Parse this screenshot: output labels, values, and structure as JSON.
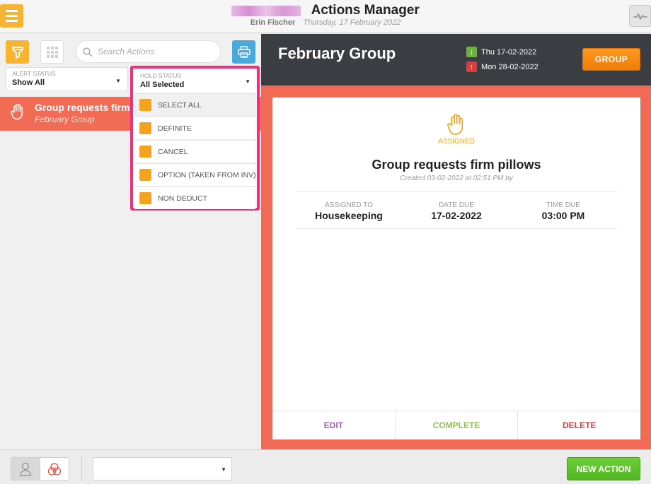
{
  "header": {
    "title": "Actions Manager",
    "user": "Erin Fischer",
    "date": "Thursday, 17 February 2022"
  },
  "icons": {
    "menu": "hamburger-icon",
    "activity": "pulse-icon",
    "filter": "filter-icon",
    "grid": "grid-icon",
    "search": "search-icon",
    "print": "printer-icon",
    "hand": "hand-icon",
    "person": "person-icon",
    "rings": "rings-icon"
  },
  "toolbar": {
    "search_placeholder": "Search Actions"
  },
  "filters": {
    "alert_status": {
      "label": "ALERT STATUS",
      "value": "Show All"
    },
    "hold_status": {
      "label": "HOLD STATUS",
      "value": "All Selected",
      "options": [
        "SELECT ALL",
        "DEFINITE",
        "CANCEL",
        "OPTION (TAKEN FROM INV)",
        "NON DEDUCT"
      ]
    }
  },
  "action_list": [
    {
      "title": "Group requests firm pillows",
      "subtitle": "February Group"
    }
  ],
  "detail": {
    "group_name": "February Group",
    "arrival": "Thu 17-02-2022",
    "departure": "Mon 28-02-2022",
    "group_button": "GROUP",
    "status": "ASSIGNED",
    "title": "Group requests firm pillows",
    "created": "Created 03-02-2022 at 02:51 PM by",
    "assigned_to_label": "ASSIGNED TO",
    "assigned_to": "Housekeeping",
    "date_due_label": "DATE DUE",
    "date_due": "17-02-2022",
    "time_due_label": "TIME DUE",
    "time_due": "03:00 PM",
    "edit": "EDIT",
    "complete": "COMPLETE",
    "delete": "DELETE"
  },
  "footer": {
    "new_action": "NEW ACTION"
  },
  "colors": {
    "accent_orange": "#f7b431",
    "item_highlight": "#f16b55",
    "dropdown_border": "#f0307a",
    "header_dark": "#3a3d41",
    "new_action_green": "#5cc22c"
  }
}
